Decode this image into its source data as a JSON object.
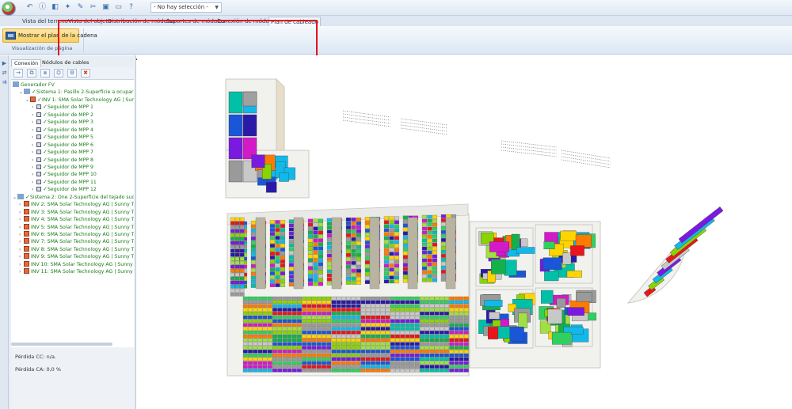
{
  "selector": {
    "value": "- No hay selección -"
  },
  "tabs": [
    {
      "label": "Vista del terreno",
      "active": false
    },
    {
      "label": "Vista del objeto",
      "active": false
    },
    {
      "label": "Distribución de módulos",
      "active": false
    },
    {
      "label": "Soportes de módulos",
      "active": false
    },
    {
      "label": "Conexión de módulos",
      "active": false
    },
    {
      "label": "Plan de cableado",
      "active": true
    }
  ],
  "ribbon": {
    "button_label": "Mostrar el plan de la cadena",
    "group_label": "Visualización de página"
  },
  "panel": {
    "tabs": [
      {
        "label": "Conexión",
        "active": true
      },
      {
        "label": "Nódulos de cables",
        "active": false
      }
    ],
    "tree": [
      {
        "label": "Generador FV",
        "level": 0,
        "kind": "gen"
      },
      {
        "label": "Sistema 1:  Pasillo 2-Superficie a ocupar Oeste...",
        "level": 1,
        "kind": "sys"
      },
      {
        "label": "INV 1: SMA Solar Technology AG | Sunny T...",
        "level": 2,
        "kind": "inv",
        "checked": true
      },
      {
        "label": "Seguidor de MPP 1",
        "level": 3,
        "kind": "mpp"
      },
      {
        "label": "Seguidor de MPP 2",
        "level": 3,
        "kind": "mpp"
      },
      {
        "label": "Seguidor de MPP 3",
        "level": 3,
        "kind": "mpp"
      },
      {
        "label": "Seguidor de MPP 4",
        "level": 3,
        "kind": "mpp"
      },
      {
        "label": "Seguidor de MPP 5",
        "level": 3,
        "kind": "mpp"
      },
      {
        "label": "Seguidor de MPP 6",
        "level": 3,
        "kind": "mpp"
      },
      {
        "label": "Seguidor de MPP 7",
        "level": 3,
        "kind": "mpp"
      },
      {
        "label": "Seguidor de MPP 8",
        "level": 3,
        "kind": "mpp"
      },
      {
        "label": "Seguidor de MPP 9",
        "level": 3,
        "kind": "mpp"
      },
      {
        "label": "Seguidor de MPP 10",
        "level": 3,
        "kind": "mpp"
      },
      {
        "label": "Seguidor de MPP 11",
        "level": 3,
        "kind": "mpp"
      },
      {
        "label": "Seguidor de MPP 12",
        "level": 3,
        "kind": "mpp"
      },
      {
        "label": "Sistema 2:  One 2-Superficie del tejado sudeste + ...",
        "level": 0,
        "kind": "sys"
      },
      {
        "label": "INV 2: SMA Solar Technology AG | Sunny Tripo...",
        "level": 1,
        "kind": "inv"
      },
      {
        "label": "INV 3: SMA Solar Technology AG | Sunny Tripo...",
        "level": 1,
        "kind": "inv"
      },
      {
        "label": "INV 4: SMA Solar Technology AG | Sunny Tripo...",
        "level": 1,
        "kind": "inv"
      },
      {
        "label": "INV 5: SMA Solar Technology AG | Sunny Tripo...",
        "level": 1,
        "kind": "inv"
      },
      {
        "label": "INV 6: SMA Solar Technology AG | Sunny Tripo...",
        "level": 1,
        "kind": "inv"
      },
      {
        "label": "INV 7: SMA Solar Technology AG | Sunny Tripo...",
        "level": 1,
        "kind": "inv"
      },
      {
        "label": "INV 8: SMA Solar Technology AG | Sunny Tripo...",
        "level": 1,
        "kind": "inv"
      },
      {
        "label": "INV 9: SMA Solar Technology AG | Sunny Tripo...",
        "level": 1,
        "kind": "inv"
      },
      {
        "label": "INV 10: SMA Solar Technology AG | Sunny Tripo...",
        "level": 1,
        "kind": "inv"
      },
      {
        "label": "INV 11: SMA Solar Technology AG | Sunny Tripo...",
        "level": 1,
        "kind": "inv"
      }
    ],
    "loss_dc": "Pérdida CC: n/a.",
    "loss_ac": "Pérdida CA: 0,0 %"
  },
  "colors": {
    "highlight": "#e0141e",
    "string_palette": [
      "#e8161b",
      "#ff7a00",
      "#ffd400",
      "#8bd400",
      "#16b04a",
      "#00c0a8",
      "#12b8e8",
      "#1a56d8",
      "#2a1aa8",
      "#7a1ae0",
      "#d21ac8",
      "#9a9a9a",
      "#c8c8c8",
      "#30d060",
      "#a0e040"
    ]
  }
}
